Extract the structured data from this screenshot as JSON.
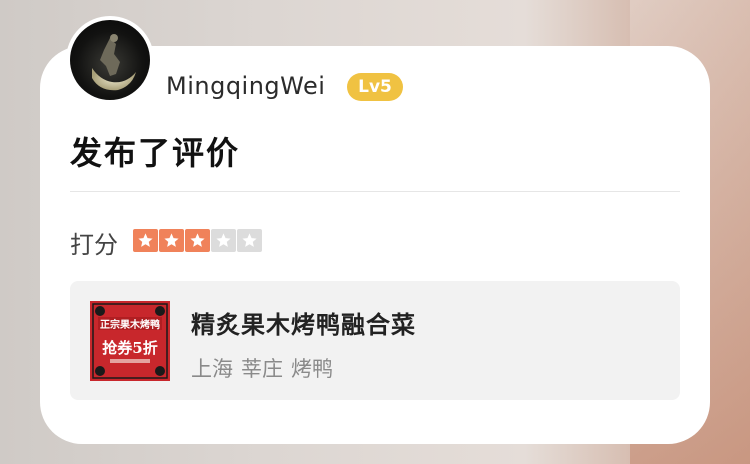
{
  "user": {
    "name": "MingqingWei",
    "level": "Lv5",
    "avatar_icon": "moon-figure-avatar"
  },
  "post": {
    "title": "发布了评价"
  },
  "rating": {
    "label": "打分",
    "value": 3,
    "max": 5,
    "on_color": "#f0825a",
    "off_color": "#dcdcdc"
  },
  "shop": {
    "name": "精炙果木烤鸭融合菜",
    "city": "上海",
    "district": "莘庄",
    "category": "烤鸭",
    "thumb_texts": {
      "headline": "正宗果木烤鸭",
      "promo": "抢券5折"
    }
  },
  "colors": {
    "badge": "#f0c242",
    "thumb": "#c8272c"
  }
}
